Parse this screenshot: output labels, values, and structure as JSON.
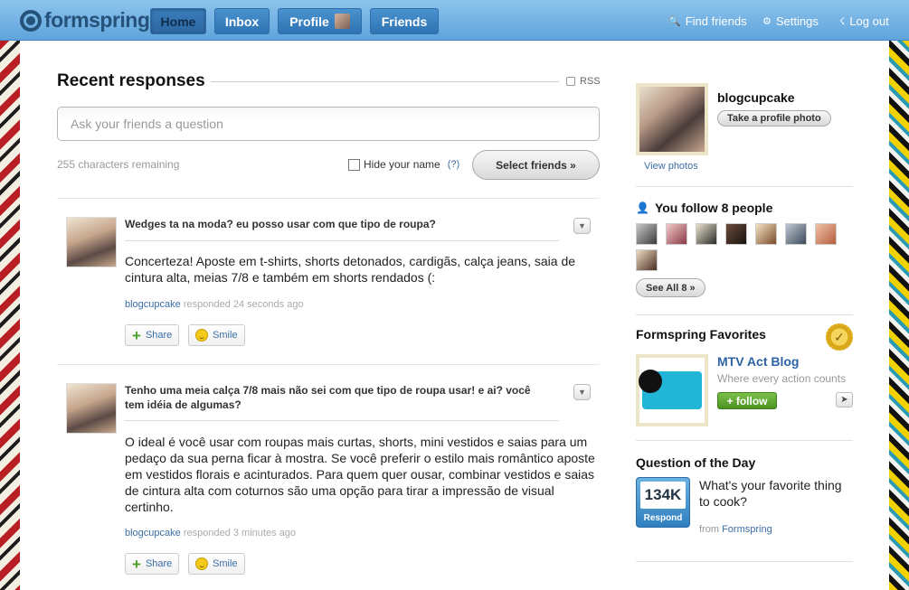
{
  "brand": {
    "name": "formspring"
  },
  "nav": {
    "home": "Home",
    "inbox": "Inbox",
    "profile": "Profile",
    "friends": "Friends",
    "find_friends": "Find friends",
    "settings": "Settings",
    "logout": "Log out"
  },
  "main": {
    "title": "Recent responses",
    "rss": "RSS",
    "ask_placeholder": "Ask your friends a question",
    "chars_remaining": "255 characters remaining",
    "hide_name": "Hide your name",
    "help": "(?)",
    "select_friends": "Select friends »"
  },
  "responses": [
    {
      "question": "Wedges ta na moda? eu posso usar com que tipo de roupa?",
      "answer": "Concerteza! Aposte em t-shirts, shorts detonados, cardigãs, calça jeans, saia de cintura alta, meias 7/8 e também em shorts rendados (:",
      "user": "blogcupcake",
      "time": "responded 24 seconds ago",
      "share": "Share",
      "smile": "Smile"
    },
    {
      "question": "Tenho uma meia calça 7/8 mais não sei com que tipo de roupa usar! e ai? você tem idéia de algumas?",
      "answer": "O ideal é você usar com roupas mais curtas, shorts, mini vestidos e saias para um pedaço da sua perna ficar à mostra. Se você preferir o estilo mais romântico aposte em vestidos florais e acinturados. Para quem quer ousar, combinar vestidos e saias de cintura alta com coturnos são uma opção para tirar a impressão de visual certinho.",
      "user": "blogcupcake",
      "time": "responded 3 minutes ago",
      "share": "Share",
      "smile": "Smile"
    }
  ],
  "sidebar": {
    "username": "blogcupcake",
    "take_photo": "Take a profile photo",
    "view_photos": "View photos",
    "follow_title": "You follow 8 people",
    "see_all": "See All 8 »",
    "favorites_title": "Formspring Favorites",
    "favorite_name": "MTV Act Blog",
    "favorite_sub": "Where every action counts",
    "follow_btn": "+ follow",
    "qotd_title": "Question of the Day",
    "qotd_count": "134K",
    "qotd_respond": "Respond",
    "qotd_question": "What's your favorite thing to cook?",
    "qotd_from": "from",
    "qotd_from_link": "Formspring"
  },
  "colors": {
    "topbar": "#6aaee2",
    "link": "#3a6ea5",
    "follow_green": "#5ea32f"
  }
}
